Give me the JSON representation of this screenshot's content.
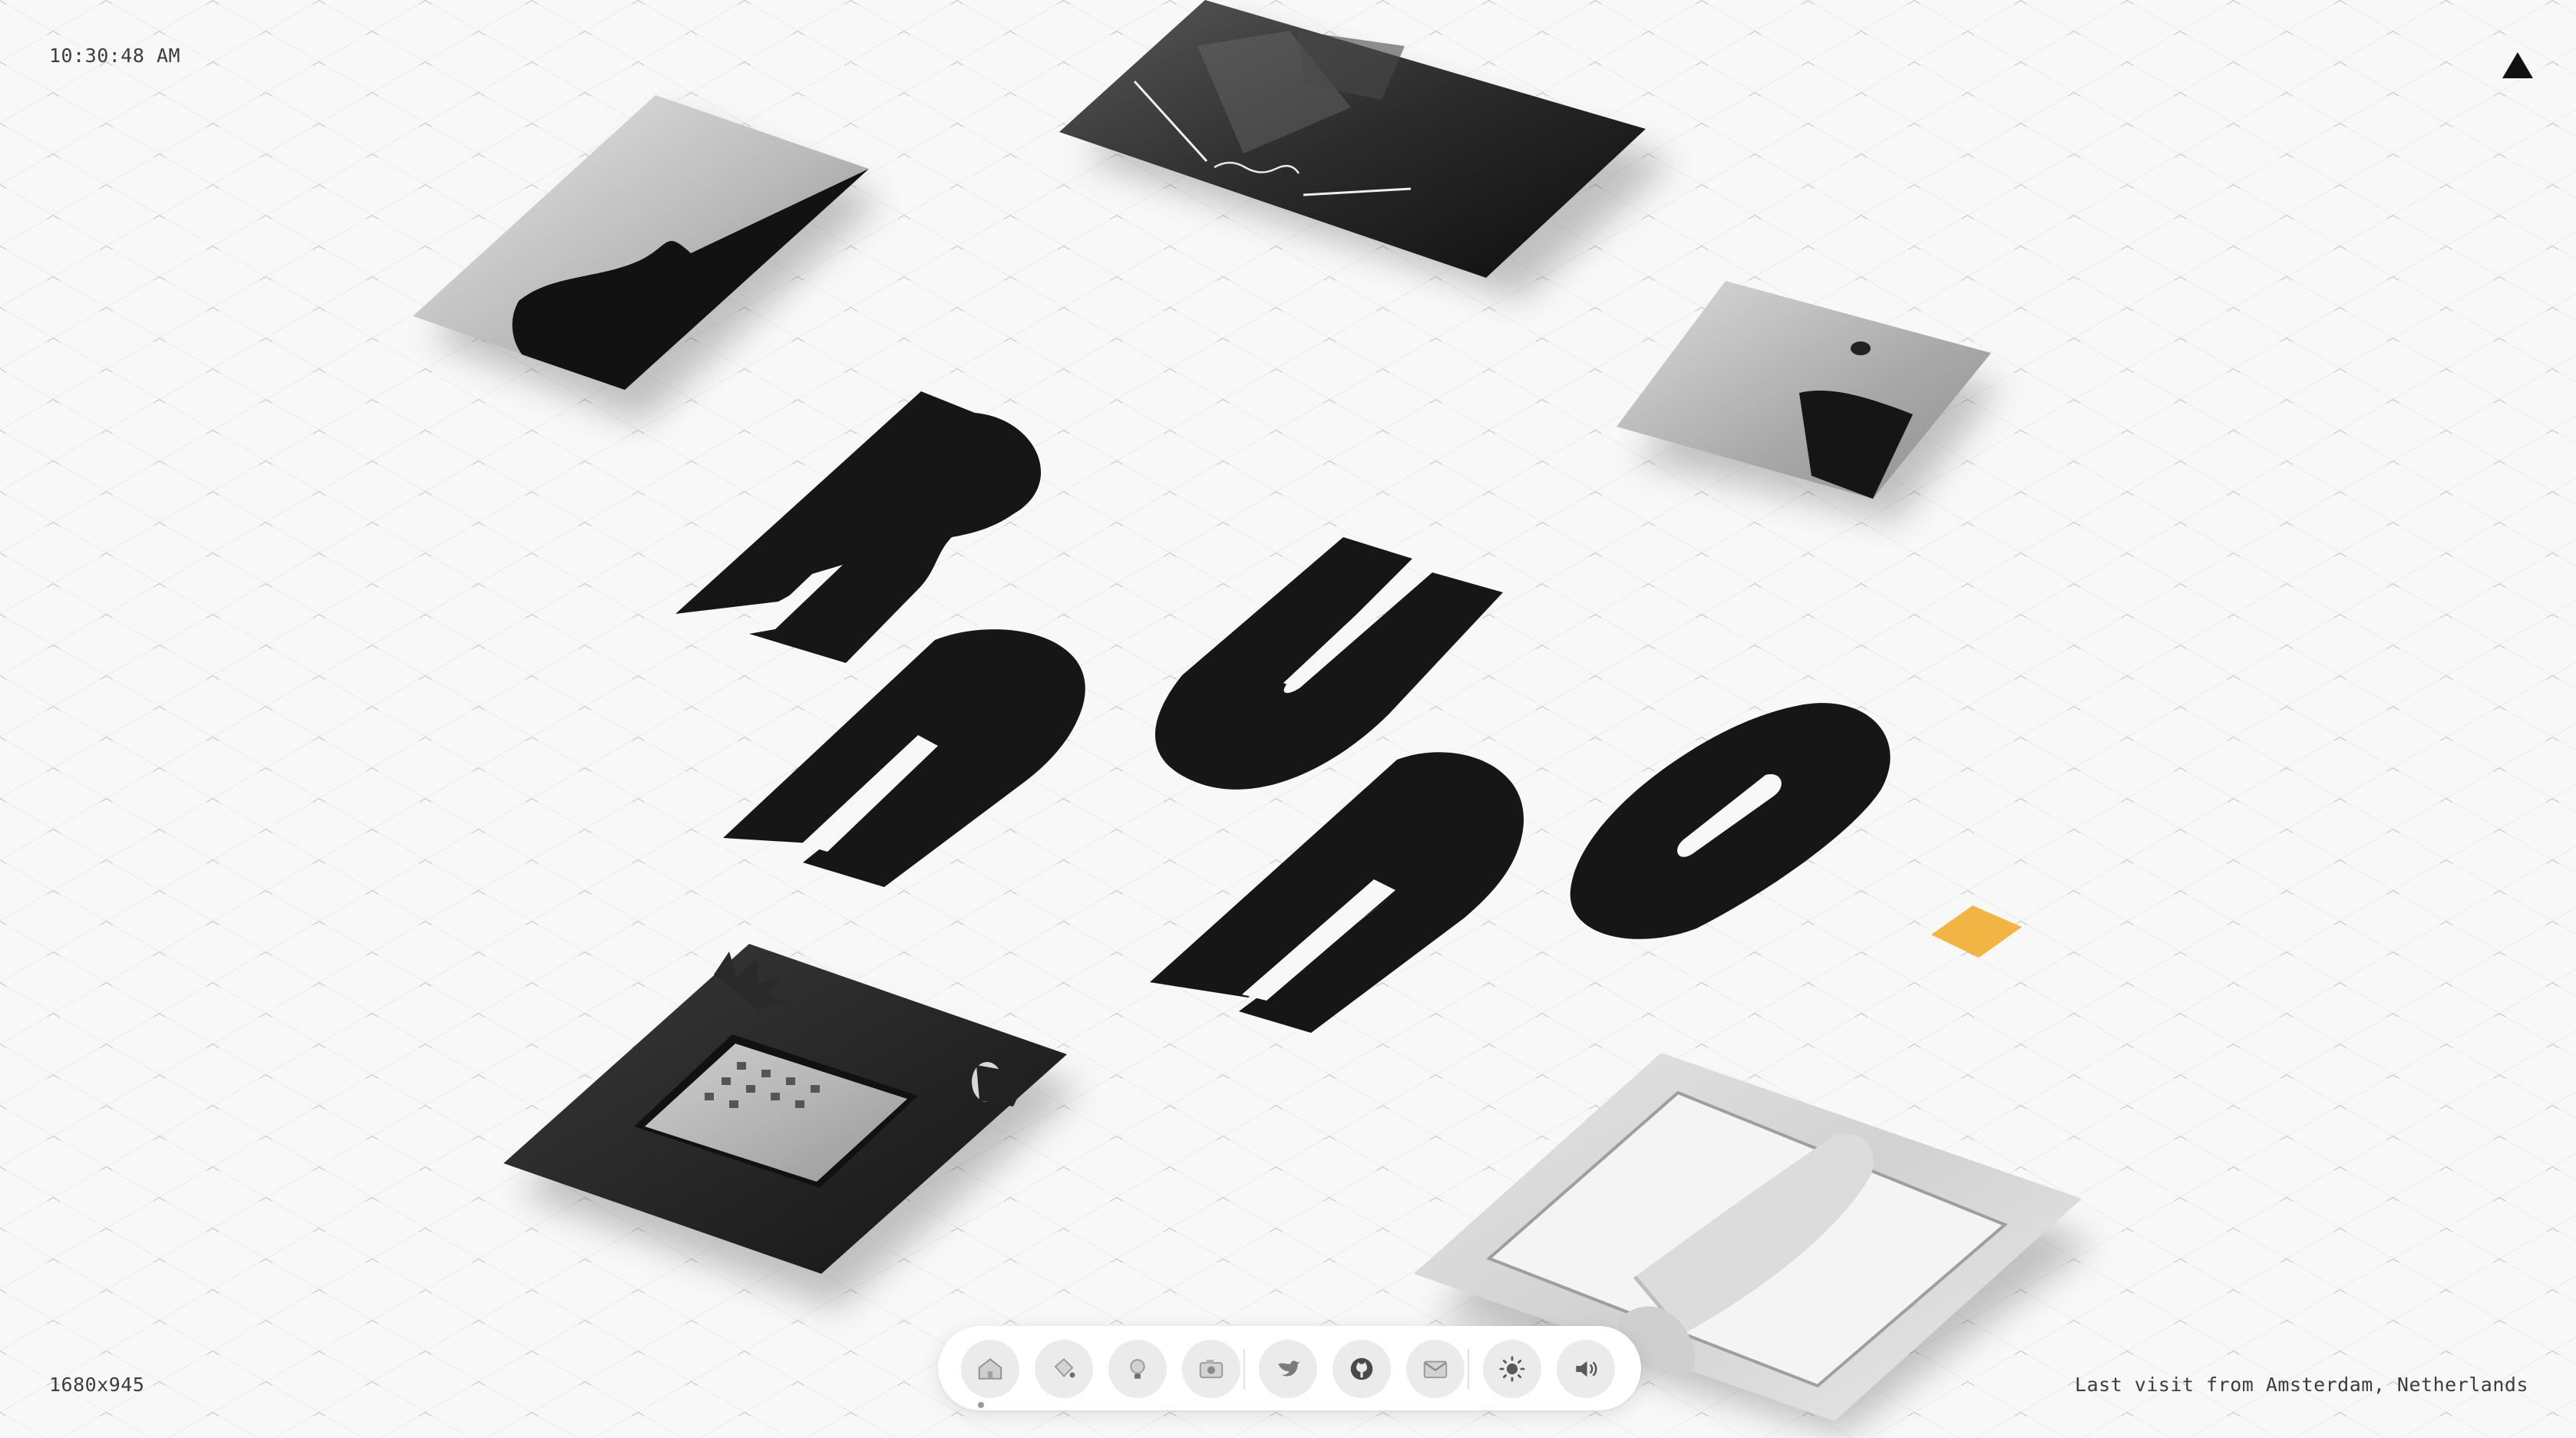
{
  "status": {
    "clock": "10:30:48 AM",
    "viewport_size": "1680x945",
    "last_visit": "Last visit from Amsterdam, Netherlands"
  },
  "brand": {
    "name": "Rauno.",
    "accent": "#f2b544",
    "ink": "#161616"
  },
  "dock": {
    "items": [
      {
        "icon": "home-icon",
        "active": true
      },
      {
        "icon": "paint-bucket-icon"
      },
      {
        "icon": "lightbulb-icon"
      },
      {
        "icon": "camera-icon"
      },
      {
        "icon": "twitter-bird-icon"
      },
      {
        "icon": "github-icon"
      },
      {
        "icon": "mail-icon"
      },
      {
        "icon": "sun-icon"
      },
      {
        "icon": "speaker-icon"
      }
    ]
  },
  "cards": [
    {
      "name": "card-wave-shape",
      "tone": "light"
    },
    {
      "name": "card-night-photo",
      "tone": "dark"
    },
    {
      "name": "card-dot-shape",
      "tone": "light"
    },
    {
      "name": "card-tablet-desk",
      "tone": "dark"
    },
    {
      "name": "card-open-book",
      "tone": "marble"
    }
  ]
}
